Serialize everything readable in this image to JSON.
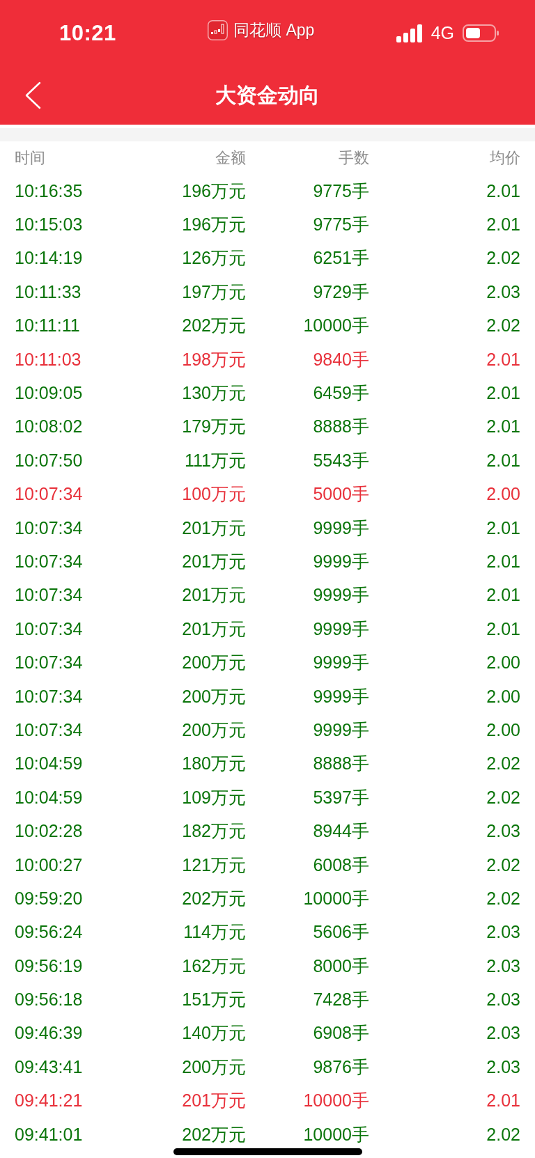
{
  "status_bar": {
    "time": "10:21",
    "app_name": "同花顺 App",
    "network": "4G"
  },
  "nav_bar": {
    "title": "大资金动向"
  },
  "table": {
    "columns": [
      "时间",
      "金额",
      "手数",
      "均价"
    ],
    "rows": [
      {
        "time": "10:16:35",
        "amount": "196万元",
        "lots": "9775手",
        "avg_price": "2.01",
        "color": "#0b750b"
      },
      {
        "time": "10:15:03",
        "amount": "196万元",
        "lots": "9775手",
        "avg_price": "2.01",
        "color": "#0b750b"
      },
      {
        "time": "10:14:19",
        "amount": "126万元",
        "lots": "6251手",
        "avg_price": "2.02",
        "color": "#0b750b"
      },
      {
        "time": "10:11:33",
        "amount": "197万元",
        "lots": "9729手",
        "avg_price": "2.03",
        "color": "#0b750b"
      },
      {
        "time": "10:11:11",
        "amount": "202万元",
        "lots": "10000手",
        "avg_price": "2.02",
        "color": "#0b750b"
      },
      {
        "time": "10:11:03",
        "amount": "198万元",
        "lots": "9840手",
        "avg_price": "2.01",
        "color": "#e8313b"
      },
      {
        "time": "10:09:05",
        "amount": "130万元",
        "lots": "6459手",
        "avg_price": "2.01",
        "color": "#0b750b"
      },
      {
        "time": "10:08:02",
        "amount": "179万元",
        "lots": "8888手",
        "avg_price": "2.01",
        "color": "#0b750b"
      },
      {
        "time": "10:07:50",
        "amount": "111万元",
        "lots": "5543手",
        "avg_price": "2.01",
        "color": "#0b750b"
      },
      {
        "time": "10:07:34",
        "amount": "100万元",
        "lots": "5000手",
        "avg_price": "2.00",
        "color": "#e8313b"
      },
      {
        "time": "10:07:34",
        "amount": "201万元",
        "lots": "9999手",
        "avg_price": "2.01",
        "color": "#0b750b"
      },
      {
        "time": "10:07:34",
        "amount": "201万元",
        "lots": "9999手",
        "avg_price": "2.01",
        "color": "#0b750b"
      },
      {
        "time": "10:07:34",
        "amount": "201万元",
        "lots": "9999手",
        "avg_price": "2.01",
        "color": "#0b750b"
      },
      {
        "time": "10:07:34",
        "amount": "201万元",
        "lots": "9999手",
        "avg_price": "2.01",
        "color": "#0b750b"
      },
      {
        "time": "10:07:34",
        "amount": "200万元",
        "lots": "9999手",
        "avg_price": "2.00",
        "color": "#0b750b"
      },
      {
        "time": "10:07:34",
        "amount": "200万元",
        "lots": "9999手",
        "avg_price": "2.00",
        "color": "#0b750b"
      },
      {
        "time": "10:07:34",
        "amount": "200万元",
        "lots": "9999手",
        "avg_price": "2.00",
        "color": "#0b750b"
      },
      {
        "time": "10:04:59",
        "amount": "180万元",
        "lots": "8888手",
        "avg_price": "2.02",
        "color": "#0b750b"
      },
      {
        "time": "10:04:59",
        "amount": "109万元",
        "lots": "5397手",
        "avg_price": "2.02",
        "color": "#0b750b"
      },
      {
        "time": "10:02:28",
        "amount": "182万元",
        "lots": "8944手",
        "avg_price": "2.03",
        "color": "#0b750b"
      },
      {
        "time": "10:00:27",
        "amount": "121万元",
        "lots": "6008手",
        "avg_price": "2.02",
        "color": "#0b750b"
      },
      {
        "time": "09:59:20",
        "amount": "202万元",
        "lots": "10000手",
        "avg_price": "2.02",
        "color": "#0b750b"
      },
      {
        "time": "09:56:24",
        "amount": "114万元",
        "lots": "5606手",
        "avg_price": "2.03",
        "color": "#0b750b"
      },
      {
        "time": "09:56:19",
        "amount": "162万元",
        "lots": "8000手",
        "avg_price": "2.03",
        "color": "#0b750b"
      },
      {
        "time": "09:56:18",
        "amount": "151万元",
        "lots": "7428手",
        "avg_price": "2.03",
        "color": "#0b750b"
      },
      {
        "time": "09:46:39",
        "amount": "140万元",
        "lots": "6908手",
        "avg_price": "2.03",
        "color": "#0b750b"
      },
      {
        "time": "09:43:41",
        "amount": "200万元",
        "lots": "9876手",
        "avg_price": "2.03",
        "color": "#0b750b"
      },
      {
        "time": "09:41:21",
        "amount": "201万元",
        "lots": "10000手",
        "avg_price": "2.01",
        "color": "#e8313b"
      },
      {
        "time": "09:41:01",
        "amount": "202万元",
        "lots": "10000手",
        "avg_price": "2.02",
        "color": "#0b750b"
      }
    ]
  }
}
